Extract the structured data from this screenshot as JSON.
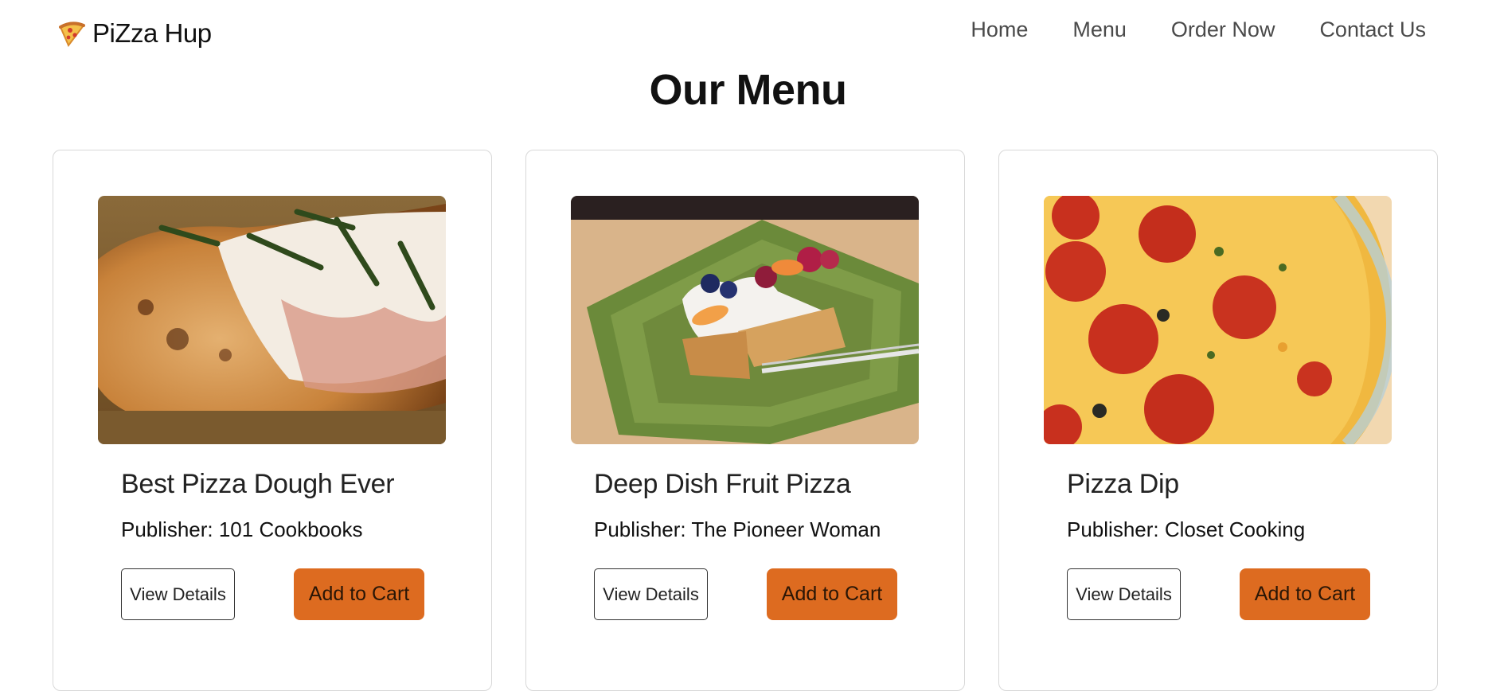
{
  "brand": {
    "name": "PiZza Hup",
    "icon": "pizza-slice-icon"
  },
  "nav": {
    "items": [
      {
        "label": "Home"
      },
      {
        "label": "Menu"
      },
      {
        "label": "Order Now"
      },
      {
        "label": "Contact Us"
      }
    ]
  },
  "page": {
    "title": "Our Menu"
  },
  "colors": {
    "accent": "#dd6b20",
    "text": "#111111",
    "nav_text": "#4a4a4a",
    "card_border": "#d8d8d8"
  },
  "cards": [
    {
      "title": "Best Pizza Dough Ever",
      "publisher": "Publisher: 101 Cookbooks",
      "image": "pizza-closeup-photo",
      "details_label": "View Details",
      "cart_label": "Add to Cart"
    },
    {
      "title": "Deep Dish Fruit Pizza",
      "publisher": "Publisher: The Pioneer Woman",
      "image": "fruit-pizza-on-green-plate-photo",
      "details_label": "View Details",
      "cart_label": "Add to Cart"
    },
    {
      "title": "Pizza Dip",
      "publisher": "Publisher: Closet Cooking",
      "image": "pepperoni-pizza-dip-photo",
      "details_label": "View Details",
      "cart_label": "Add to Cart"
    }
  ]
}
